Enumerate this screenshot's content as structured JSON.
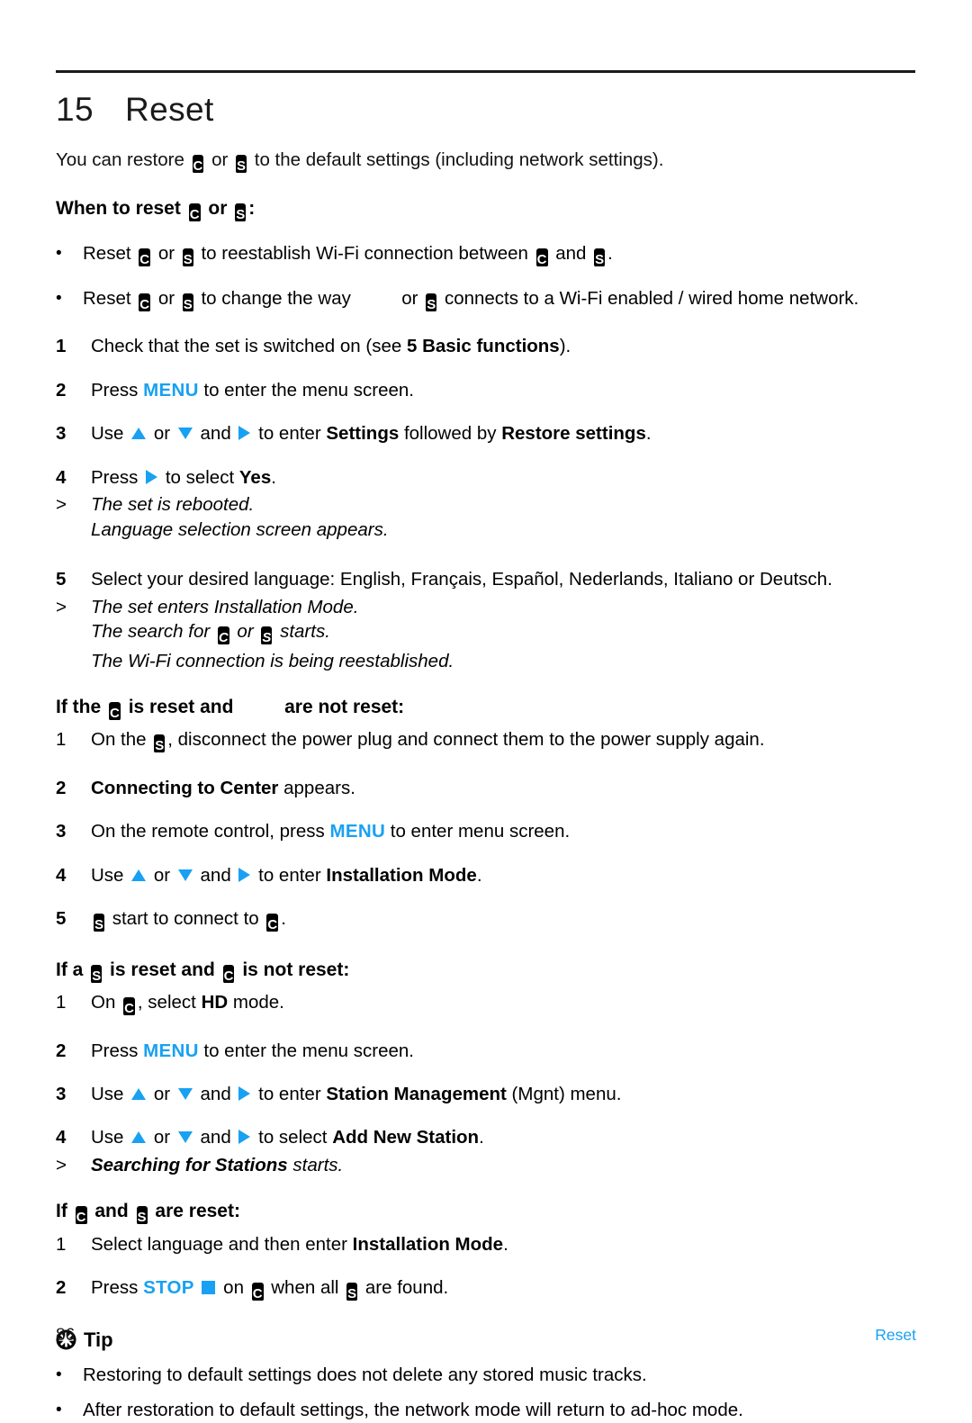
{
  "document": {
    "chapter_number": "15",
    "chapter_title": "Reset",
    "page_number": "86",
    "footer_chapter": "Reset"
  },
  "icons": {
    "center_label": "C",
    "station_label": "S",
    "tip_icon": "asterisk-icon",
    "up_arrow": "triangle-up-icon",
    "down_arrow": "triangle-down-icon",
    "right_arrow": "triangle-right-icon",
    "stop_square": "stop-square-icon"
  },
  "colors": {
    "accent": "#18a1f2",
    "text": "#111111",
    "rule": "#1a1a1a"
  },
  "intro": {
    "t1": "You can restore",
    "t2": "or",
    "t3": "to the default settings (including network settings)."
  },
  "when_to_reset": {
    "heading_a": "When to reset",
    "heading_or": "or",
    "heading_colon": ":",
    "bullets": [
      {
        "marker": "•",
        "t1": "Reset",
        "t2": "or",
        "t3": "to reestablish Wi-Fi connection between",
        "t4": "and",
        "t5": "."
      },
      {
        "marker": "•",
        "t1": "Reset",
        "t2": "or",
        "t3": "to change the way",
        "t4": "or",
        "t5": "connects to a Wi-Fi enabled / wired home network."
      }
    ]
  },
  "main_steps": [
    {
      "marker": "1",
      "t1": "Check that the set is switched on (see",
      "bold1": "5 Basic functions",
      "t2": ")."
    },
    {
      "marker": "2",
      "t1": "Press",
      "accent1": "MENU",
      "t2": "to enter the menu screen."
    },
    {
      "marker": "3",
      "t1": "Use",
      "t2": "or",
      "t3": "and",
      "t4": "to enter",
      "bold1": "Settings",
      "t5": "followed by",
      "bold2": "Restore settings",
      "t6": "."
    },
    {
      "marker": "4",
      "t1": "Press",
      "t2": "to select",
      "bold1": "Yes",
      "t3": "."
    }
  ],
  "result_1": {
    "marker": ">",
    "line1": "The set is rebooted.",
    "line2": "Language selection screen appears."
  },
  "step_5": {
    "marker": "5",
    "text": "Select your desired language: English, Français, Español, Nederlands, Italiano or Deutsch."
  },
  "result_2": {
    "marker": ">",
    "line1": "The set enters Installation Mode.",
    "line2_a": "The search for",
    "line2_b": "or",
    "line2_c": "starts.",
    "line3": "The Wi-Fi connection is being reestablished."
  },
  "section_center_reset": {
    "heading_a": "If the",
    "heading_b": "is reset and",
    "heading_c": "are not reset:",
    "steps": [
      {
        "marker": "1",
        "t1": "On the",
        "t2": ", disconnect the power plug and connect them to the power supply again."
      },
      {
        "marker": "2",
        "bold1": "Connecting to Center",
        "t1": "appears."
      },
      {
        "marker": "3",
        "t1": "On the remote control, press",
        "accent1": "MENU",
        "t2": "to enter menu screen."
      },
      {
        "marker": "4",
        "t1": "Use",
        "t2": "or",
        "t3": "and",
        "t4": "to enter",
        "bold1": "Installation Mode",
        "t5": "."
      },
      {
        "marker": "5",
        "t1": "start to connect to",
        "t2": "."
      }
    ]
  },
  "section_station_reset": {
    "heading_a": "If a",
    "heading_b": "is reset and",
    "heading_c": "is not reset:",
    "steps": [
      {
        "marker": "1",
        "t1": "On",
        "t2": ", select",
        "bold1": "HD",
        "t3": "mode."
      },
      {
        "marker": "2",
        "t1": "Press",
        "accent1": "MENU",
        "t2": "to enter the menu screen."
      },
      {
        "marker": "3",
        "t1": "Use",
        "t2": "or",
        "t3": "and",
        "t4": "to enter",
        "bold1": "Station Management",
        "t5": "(Mgnt) menu."
      },
      {
        "marker": "4",
        "t1": "Use",
        "t2": "or",
        "t3": "and",
        "t4": "to select",
        "bold1": "Add New Station",
        "t5": "."
      }
    ],
    "result": {
      "marker": ">",
      "bold1": "Searching for Stations",
      "t1": "starts."
    }
  },
  "section_both_reset": {
    "heading_a": "If",
    "heading_b": "and",
    "heading_c": "are reset:",
    "steps": [
      {
        "marker": "1",
        "t1": "Select language and then enter",
        "bold1": "Installation Mode",
        "t2": "."
      },
      {
        "marker": "2",
        "t1": "Press",
        "accent1": "STOP",
        "t2": "on",
        "t3": "when all",
        "t4": "are found."
      }
    ]
  },
  "tip": {
    "title": "Tip",
    "items": [
      {
        "marker": "•",
        "text": "Restoring to default settings does not delete any stored music tracks."
      },
      {
        "marker": "•",
        "text": "After restoration to default settings, the network mode will return to ad-hoc mode."
      }
    ]
  }
}
